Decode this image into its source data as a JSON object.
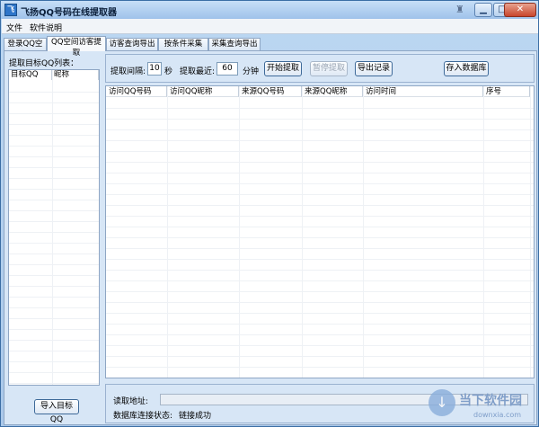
{
  "window": {
    "title": "飞扬QQ号码在线提取器"
  },
  "titlebar": {
    "app_icon": "app-icon",
    "skin_icon": "skin-icon",
    "minimize": "▁",
    "maximize": "□",
    "close": "✕"
  },
  "menu": {
    "items": [
      "文件",
      "软件说明"
    ]
  },
  "tabs": [
    {
      "label": "登录QQ空间",
      "active": false
    },
    {
      "label": "QQ空间访客提取",
      "active": true
    },
    {
      "label": "访客查询导出",
      "active": false
    },
    {
      "label": "按条件采集QQ",
      "active": false
    },
    {
      "label": "采集查询导出",
      "active": false
    }
  ],
  "left": {
    "label": "提取目标QQ列表：",
    "columns": [
      "目标QQ",
      "昵称"
    ],
    "import_button": "导入目标QQ"
  },
  "toolbar": {
    "interval_label": "提取间隔:",
    "interval_value": "10",
    "interval_unit": "秒",
    "recent_label": "提取最近:",
    "recent_value": "60",
    "recent_unit": "分钟",
    "start_button": "开始提取",
    "pause_button": "暂停提取",
    "export_button": "导出记录",
    "save_db_button": "存入数据库"
  },
  "table": {
    "columns": [
      "访问QQ号码",
      "访问QQ昵称",
      "来源QQ号码",
      "来源QQ昵称",
      "访问时间",
      "序号"
    ]
  },
  "status": {
    "address_label": "读取地址:",
    "db_status_label": "数据库连接状态:",
    "db_status_value": "链接成功"
  },
  "watermark": {
    "text": "当下软件园",
    "sub": "downxia.com"
  }
}
